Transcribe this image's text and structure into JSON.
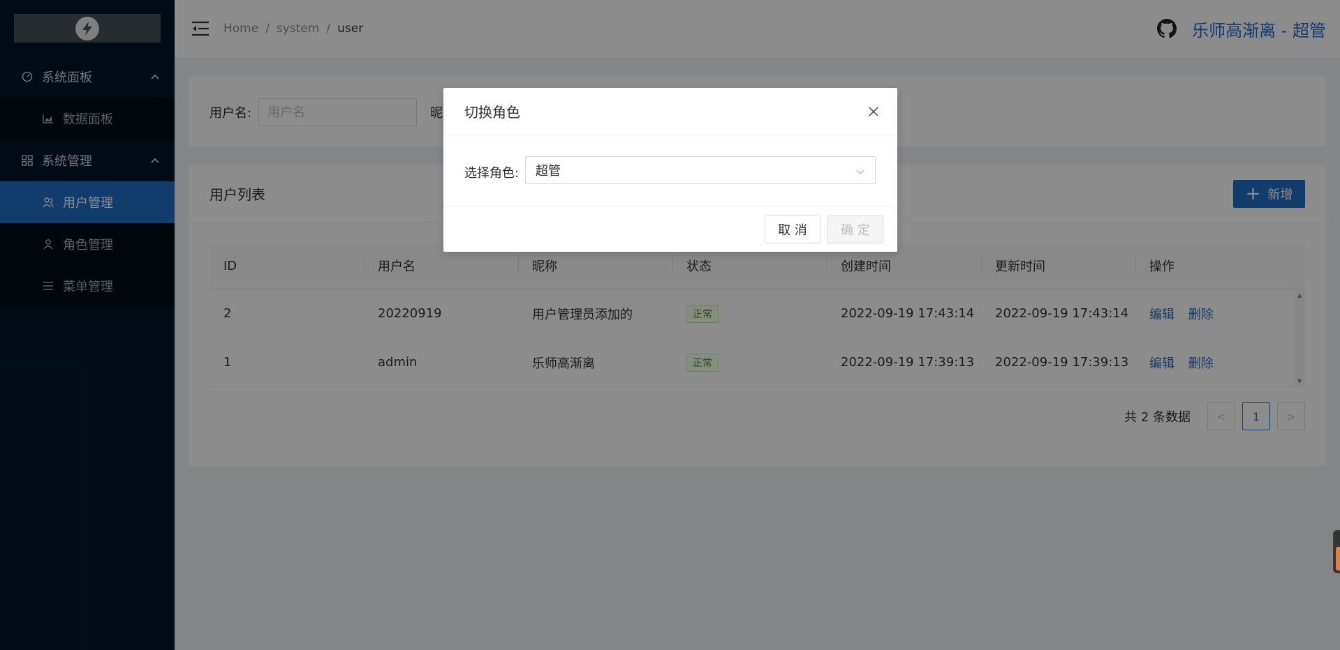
{
  "sidebar": {
    "groups": [
      {
        "label": "系统面板",
        "items": [
          {
            "label": "数据面板"
          }
        ]
      },
      {
        "label": "系统管理",
        "items": [
          {
            "label": "用户管理"
          },
          {
            "label": "角色管理"
          },
          {
            "label": "菜单管理"
          }
        ]
      }
    ],
    "active_item": "用户管理"
  },
  "header": {
    "breadcrumb": [
      "Home",
      "system",
      "user"
    ],
    "breadcrumb_sep": "/",
    "user_display": "乐师高渐离 - 超管"
  },
  "search": {
    "username_label": "用户名:",
    "username_placeholder": "用户名",
    "nickname_label_partial": "昵"
  },
  "list": {
    "title": "用户列表",
    "add_label": "新增",
    "columns": [
      "ID",
      "用户名",
      "昵称",
      "状态",
      "创建时间",
      "更新时间",
      "操作"
    ],
    "rows": [
      {
        "id": "2",
        "username": "20220919",
        "nickname": "用户管理员添加的",
        "status": "正常",
        "created": "2022-09-19 17:43:14",
        "updated": "2022-09-19 17:43:14",
        "edit": "编辑",
        "delete": "删除"
      },
      {
        "id": "1",
        "username": "admin",
        "nickname": "乐师高渐离",
        "status": "正常",
        "created": "2022-09-19 17:39:13",
        "updated": "2022-09-19 17:39:13",
        "edit": "编辑",
        "delete": "删除"
      }
    ]
  },
  "pagination": {
    "total_text": "共 2 条数据",
    "prev": "<",
    "current": "1",
    "next": ">"
  },
  "modal": {
    "title": "切换角色",
    "field_label": "选择角色:",
    "selected_role": "超管",
    "cancel_label": "取 消",
    "ok_label": "确 定"
  },
  "colors": {
    "sidebar_bg": "#001529",
    "accent": "#1e6fc5",
    "success_tag": "#389e0d"
  }
}
